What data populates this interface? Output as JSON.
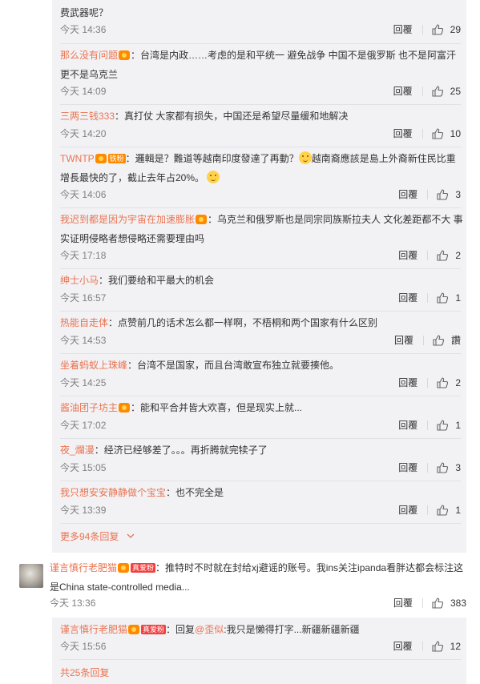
{
  "comments": [
    {
      "user": "",
      "text": "费武器呢？",
      "time": "今天 14:36",
      "reply": "回覆",
      "likes": "29"
    },
    {
      "user": "那么没有问题",
      "text": "：台湾是内政……考虑的是和平统一 避免战争 中国不是俄罗斯 也不是阿富汗 更不是乌克兰",
      "time": "今天 14:09",
      "reply": "回覆",
      "likes": "25"
    },
    {
      "user": "三两三钱333",
      "text": "：真打仗 大家都有损失，中国还是希望尽量缓和地解决",
      "time": "今天 14:20",
      "reply": "回覆",
      "likes": "10"
    },
    {
      "user": "TWNTP",
      "tag": "铁粉",
      "text1": "：邏輯是？難道等越南印度發達了再動？",
      "text2": "越南裔應該是島上外裔新住民比重增長最快的了，截止去年占20%。",
      "time": "今天 14:06",
      "reply": "回覆",
      "likes": "3"
    },
    {
      "user": "我迟到都是因为宇宙在加速膨胀",
      "text": "：乌克兰和俄罗斯也是同宗同族斯拉夫人 文化差距都不大 事实证明侵略者想侵略还需要理由吗",
      "time": "今天 17:18",
      "reply": "回覆",
      "likes": "2"
    },
    {
      "user": "绅士小马",
      "text": "：我们要给和平最大的机会",
      "time": "今天 16:57",
      "reply": "回覆",
      "likes": "1"
    },
    {
      "user": "热能自走体",
      "text": "：点赞前几的话术怎么都一样啊，不梧桐和两个国家有什么区别",
      "time": "今天 14:53",
      "reply": "回覆",
      "likes": "讚"
    },
    {
      "user": "坐着蚂蚁上珠峰",
      "text": "：台湾不是国家，而且台湾敢宣布独立就要揍他。",
      "time": "今天 14:25",
      "reply": "回覆",
      "likes": "2"
    },
    {
      "user": "酱油团子坊主",
      "text": "：能和平合并皆大欢喜，但是现实上就...",
      "time": "今天 17:02",
      "reply": "回覆",
      "likes": "1"
    },
    {
      "user": "夜_爛漫",
      "text": "：经济已经够差了。。。再折腾就完犊子了",
      "time": "今天 15:05",
      "reply": "回覆",
      "likes": "3"
    },
    {
      "user": "我只想安安静静做个宝宝",
      "text": "：也不完全是",
      "time": "今天 13:39",
      "reply": "回覆",
      "likes": "1"
    }
  ],
  "more_replies": "更多94条回复",
  "main_comment": {
    "user": "谨言慎行老肥猫",
    "tag": "真爱粉",
    "text": "：推特时不时就在封给xj避谣的账号。我ins关注ipanda看胖达都会标注这是China state-controlled media...",
    "time": "今天 13:36",
    "reply": "回覆",
    "likes": "383"
  },
  "sub_reply": {
    "user": "谨言慎行老肥猫",
    "tag": "真爱粉",
    "text_prefix": "：回复",
    "mention": "@歪似",
    "text": ":我只是懒得打字...新疆新疆新疆",
    "time": "今天 15:56",
    "reply": "回覆",
    "likes": "12"
  },
  "total_replies": "共25条回复",
  "colors": {
    "link": "#eb7350",
    "block_bg": "#f2f2f5",
    "meta": "#808080"
  },
  "icons": {
    "like": "thumbs-up-icon",
    "more": "chevron-down-icon",
    "avatar": "avatar"
  }
}
